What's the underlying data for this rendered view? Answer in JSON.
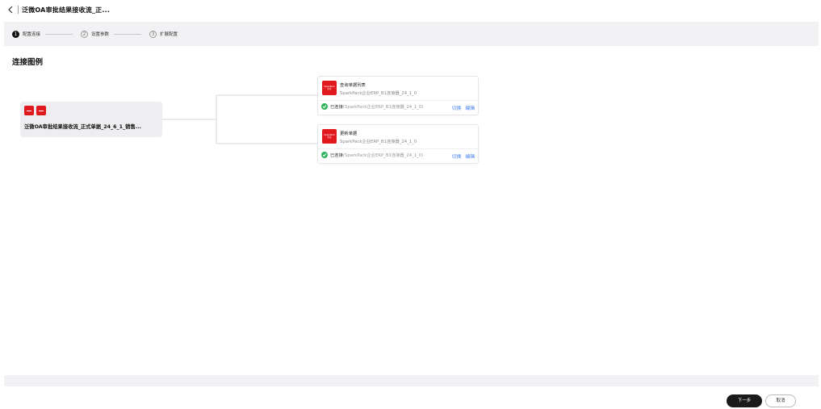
{
  "header": {
    "title": "泛微OA审批结果接收流_正..."
  },
  "steps": [
    {
      "num": "1",
      "label": "配置连接",
      "active": true
    },
    {
      "num": "2",
      "label": "设置参数",
      "active": false
    },
    {
      "num": "3",
      "label": "扩展配置",
      "active": false
    }
  ],
  "section": {
    "title": "连接图例"
  },
  "source": {
    "title": "泛微OA审批结果接收流_正式单据_24_6_1_销售..."
  },
  "targets": [
    {
      "logo_line1": "SparkPack",
      "logo_line2": "企业",
      "name": "查询单据列表",
      "subtitle": "SparkPack企业ERP_B1连接器_24_1_0",
      "status": "已连接",
      "status_detail": "(SparkPack企业ERP_B1连接器_24_1_0)",
      "switch_label": "切换",
      "edit_label": "编辑"
    },
    {
      "logo_line1": "SparkPack",
      "logo_line2": "企业",
      "name": "更新单据",
      "subtitle": "SparkPack企业ERP_B1连接器_24_1_0",
      "status": "已连接",
      "status_detail": "(SparkPack企业ERP_B1连接器_24_1_0)",
      "switch_label": "切换",
      "edit_label": "编辑"
    }
  ],
  "footer": {
    "next_label": "下一步",
    "cancel_label": "取消"
  },
  "colors": {
    "brand_red": "#e0191e",
    "link_blue": "#3d7bf0",
    "success_green": "#2fb35a"
  }
}
